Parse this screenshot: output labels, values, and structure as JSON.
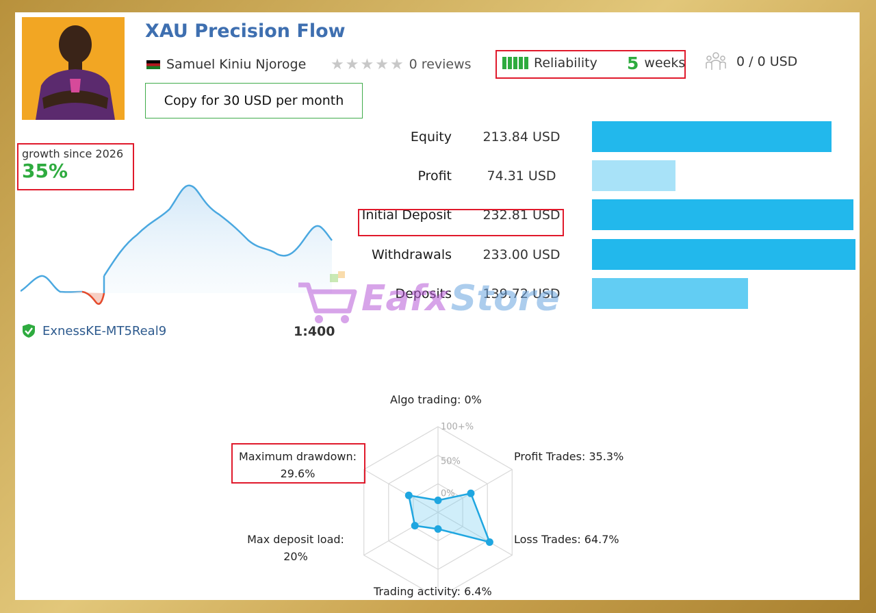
{
  "header": {
    "title": "XAU Precision Flow",
    "author": "Samuel Kiniu Njoroge",
    "reviews": "0 reviews",
    "reliability_label": "Reliability",
    "weeks_number": "5",
    "weeks_label": "weeks",
    "subscribers": "0 / 0 USD",
    "copy_button": "Copy for 30 USD per month"
  },
  "growth": {
    "label": "growth since 2026",
    "value": "35%"
  },
  "stats": [
    {
      "label": "Equity",
      "value": "213.84 USD",
      "fraction": 0.908,
      "color": "#22b8ec"
    },
    {
      "label": "Profit",
      "value": "74.31 USD",
      "fraction": 0.316,
      "color": "#a8e2f8"
    },
    {
      "label": "Initial Deposit",
      "value": "232.81 USD",
      "fraction": 0.992,
      "color": "#22b8ec"
    },
    {
      "label": "Withdrawals",
      "value": "233.00 USD",
      "fraction": 1.0,
      "color": "#22b8ec"
    },
    {
      "label": "Deposits",
      "value": "139.72 USD",
      "fraction": 0.593,
      "color": "#62cdf3"
    }
  ],
  "account": {
    "server": "ExnessKE-MT5Real9",
    "leverage": "1:400"
  },
  "radar": {
    "scale_labels": [
      "100+%",
      "50%",
      "0%"
    ],
    "axes": [
      {
        "label_lines": [
          "Algo trading: 0%"
        ],
        "value": 0
      },
      {
        "label_lines": [
          "Profit Trades: 35.3%"
        ],
        "value": 35.3
      },
      {
        "label_lines": [
          "Loss Trades: 64.7%"
        ],
        "value": 64.7
      },
      {
        "label_lines": [
          "Trading activity: 6.4%"
        ],
        "value": 6.4
      },
      {
        "label_lines": [
          "Max deposit load:",
          "20%"
        ],
        "value": 20
      },
      {
        "label_lines": [
          "Maximum drawdown:",
          "29.6%"
        ],
        "value": 29.6
      }
    ]
  },
  "watermark": {
    "part1": "Eafx",
    "part2": "Store"
  },
  "colors": {
    "title": "#3e6fb0",
    "green": "#2eab3f",
    "red_box": "#e0192b",
    "bar": "#22b8ec",
    "line": "#4aa8e0",
    "negative": "#e84a2a"
  }
}
